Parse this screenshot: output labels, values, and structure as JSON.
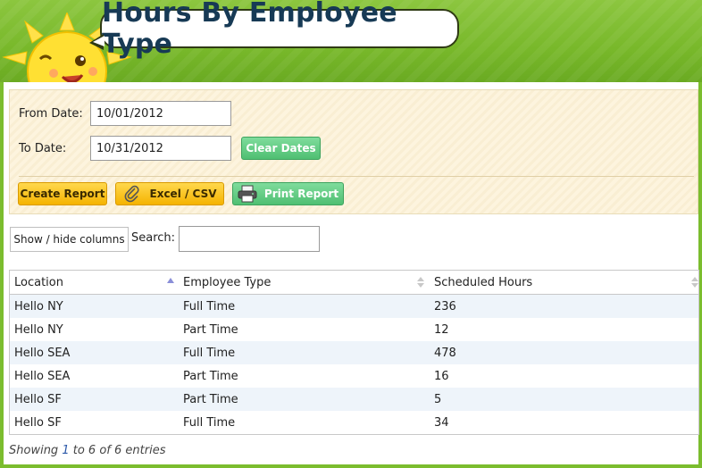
{
  "header": {
    "title": "Hours By Employee Type"
  },
  "filters": {
    "from_label": "From Date:",
    "from_value": "10/01/2012",
    "to_label": "To Date:",
    "to_value": "10/31/2012",
    "clear_dates": "Clear Dates",
    "create_report": "Create Report",
    "excel_csv": "Excel / CSV",
    "print_report": "Print Report"
  },
  "controls": {
    "show_hide": "Show / hide columns",
    "search_label": "Search:",
    "search_value": ""
  },
  "table": {
    "columns": [
      "Location",
      "Employee Type",
      "Scheduled Hours"
    ],
    "rows": [
      [
        "Hello NY",
        "Full Time",
        "236"
      ],
      [
        "Hello NY",
        "Part Time",
        "12"
      ],
      [
        "Hello SEA",
        "Full Time",
        "478"
      ],
      [
        "Hello SEA",
        "Part Time",
        "16"
      ],
      [
        "Hello SF",
        "Part Time",
        "5"
      ],
      [
        "Hello SF",
        "Full Time",
        "34"
      ]
    ],
    "info_prefix": "Showing ",
    "info_start": "1",
    "info_mid": " to ",
    "info_end": "6",
    "info_of": " of ",
    "info_total": "6",
    "info_suffix": " entries"
  },
  "colors": {
    "header_green": "#78b82a",
    "title_text": "#173a55",
    "panel_bg": "#fdf4de",
    "button_green": "#4fbf72",
    "button_yellow": "#f5b300",
    "row_alt": "#eef4fa"
  },
  "icons": {
    "mascot": "sun-mascot-icon",
    "excel": "paperclip-icon",
    "print": "printer-icon",
    "sort_location": "sort-asc-icon",
    "sort_other": "sort-both-icon"
  }
}
